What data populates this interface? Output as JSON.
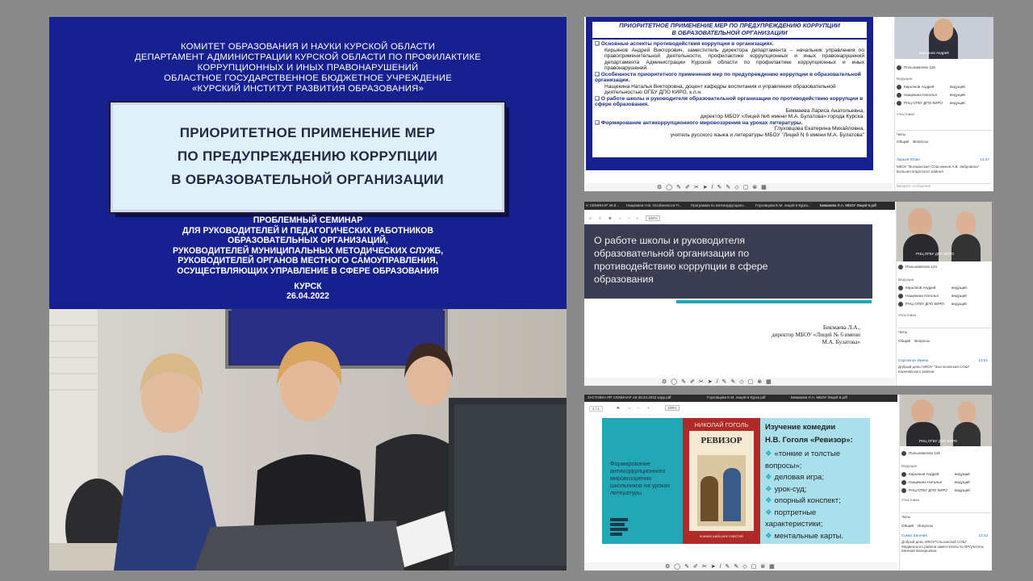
{
  "title_slide": {
    "org_lines": [
      "КОМИТЕТ ОБРАЗОВАНИЯ И НАУКИ КУРСКОЙ ОБЛАСТИ",
      "ДЕПАРТАМЕНТ АДМИНИСТРАЦИИ КУРСКОЙ ОБЛАСТИ ПО ПРОФИЛАКТИКЕ",
      "КОРРУПЦИОННЫХ И ИНЫХ ПРАВОНАРУШЕНИЙ",
      "ОБЛАСТНОЕ ГОСУДАРСТВЕННОЕ БЮДЖЕТНОЕ УЧРЕЖДЕНИЕ",
      "«КУРСКИЙ ИНСТИТУТ РАЗВИТИЯ ОБРАЗОВАНИЯ»"
    ],
    "title_lines": [
      "ПРИОРИТЕТНОЕ ПРИМЕНЕНИЕ МЕР",
      "ПО ПРЕДУПРЕЖДЕНИЮ КОРРУПЦИИ",
      "В ОБРАЗОВАТЕЛЬНОЙ ОРГАНИЗАЦИИ"
    ],
    "seminar_lines": [
      "ПРОБЛЕМНЫЙ СЕМИНАР",
      "ДЛЯ РУКОВОДИТЕЛЕЙ И ПЕДАГОГИЧЕСКИХ РАБОТНИКОВ",
      "ОБРАЗОВАТЕЛЬНЫХ ОРГАНИЗАЦИЙ,",
      "РУКОВОДИТЕЛЕЙ МУНИЦИПАЛЬНЫХ МЕТОДИЧЕСКИХ СЛУЖБ,",
      "РУКОВОДИТЕЛЕЙ ОРГАНОВ МЕСТНОГО САМОУПРАВЛЕНИЯ,",
      "ОСУЩЕСТВЛЯЮЩИХ УПРАВЛЕНИЕ В СФЕРЕ ОБРАЗОВАНИЯ"
    ],
    "city": "КУРСК",
    "date": "26.04.2022"
  },
  "panel1": {
    "title_lines": [
      "ПРИОРИТЕТНОЕ ПРИМЕНЕНИЕ МЕР ПО ПРЕДУПРЕЖДЕНИЮ КОРРУПЦИИ",
      "В ОБРАЗОВАТЕЛЬНОЙ ОРГАНИЗАЦИИ"
    ],
    "bullet1_head": "Основные аспекты противодействия коррупции в организациях.",
    "bullet1_text": "Кирьянов Андрей Викторович, заместитель директора департамента – начальник управления по правоприменительной деятельности, профилактике коррупционных и иных правонарушений департамента Администрации Курской области по профилактике коррупционных и иных правонарушений.",
    "bullet2_head": "Особенности приоритетного применения мер по предупреждению коррупции в образовательной организации.",
    "bullet2_text": "Нащекина Наталья Викторовна, доцент кафедры воспитания и управления образовательной деятельностью ОГБУ ДПО КИРО, к.п.н.",
    "bullet3_head": "О работе школы и руководителя образовательной организации по противодействию коррупции в сфере образования.",
    "bullet3_text1": "Бикмаева Лариса Анатольевна,",
    "bullet3_text2": "директор МБОУ «Лицей №6 имени М.А. Булатова» города Курска.",
    "bullet4_head": "Формирование антикоррупционного мировоззрения на уроках литературы.",
    "bullet4_text1": "Глуховцова Екатерина Михайловна,",
    "bullet4_text2": "учитель русского языка и литературы МБОУ \"Лицей N 6 имени М.А. Булатова\"",
    "cam_label": "Кирьянов Андрей",
    "participants_label": "Пользователи",
    "participants_count": "126",
    "leaders": "Ведущие",
    "participants": "Участники",
    "people": [
      "Кирьянов Андрей",
      "Нащекина Наталья",
      "РНЦ ОГБУ ДПО КИРО"
    ],
    "role": "ведущий",
    "chat_tab": "Чаты",
    "chat_general": "Общий",
    "chat_questions": "Вопросы",
    "chat_name": "Зарьев Юлия",
    "chat_time": "13:47",
    "chat_msg": "МКОУ \"Волжанская СОШ имени А.В. Забровина\" Большесолдатского района",
    "chat_input": "Введите сообщение"
  },
  "panel2": {
    "tabs": [
      "У. СЕМИНАР 26.0...",
      "Нащекина Н.В. Особенности П...",
      "Программа по антикоррупцион...",
      "Глуховцова Е.М. лицей 6 Курск...",
      "Бикмаева Л.А. МБОУ Лицей 6.pdf"
    ],
    "zoom": "100%",
    "slide_title": "О работе школы и руководителя образовательной организации по противодействию коррупции в сфере образования",
    "author1": "Бикмаева Л.А.,",
    "author2": "директор МБОУ «Лицей № 6 имени",
    "author3": "М.А. Булатова»",
    "cam_label": "РНЦ ОГБУ ДПО КИРО",
    "participants_count": "124",
    "people": [
      "Кирьянов Андрей",
      "Нащекина Наталья",
      "РНЦ ОГБУ ДПО КИРО"
    ],
    "chat_name": "Сергиенко Ирина",
    "chat_time": "13:51",
    "chat_msg": "Добрый день! МКОУ \"Заслоновская СОШ\" Кореневского района"
  },
  "panel3": {
    "tabs": [
      "ЗАСТАВКА ПР. СЕМИНАР АК 26.04.2022 корр.pdf",
      "Глуховцова Е.М. лицей 6 Курск.pdf",
      "Бикмаева Л.А. МБОУ Лицей 6.pdf"
    ],
    "zoom": "100%",
    "left_caption": "Формирование антикоррупционного мировоззрения школьников на уроках литературы",
    "book_author": "НИКОЛАЙ ГОГОЛЬ",
    "book_title": "РЕВИЗОР",
    "book_footer": "книжка шкільних повістей",
    "heading1": "Изучение комедии",
    "heading2": "Н.В. Гоголя «Ревизор»:",
    "items": [
      "«тонкие и толстые вопросы»;",
      "деловая игра;",
      "урок-суд;",
      "опорный конспект;",
      "портретные характеристики;",
      "ментальные карты."
    ],
    "cam_label": "РНЦ ОГБУ ДПО КИРО",
    "participants_count": "126",
    "chat_name": "Сумко Евгения",
    "chat_time": "13:42",
    "chat_msg": "Добрый день МКОУ\"Ольховской СОШ\" Медвенского района заместитель по ВР/учитель Евгения Валерьевна"
  },
  "colors": {
    "title_bg": "#16208f",
    "title_box": "#dff0fb",
    "accent_teal": "#23a6b5",
    "slide_dark": "#3a3c52"
  }
}
